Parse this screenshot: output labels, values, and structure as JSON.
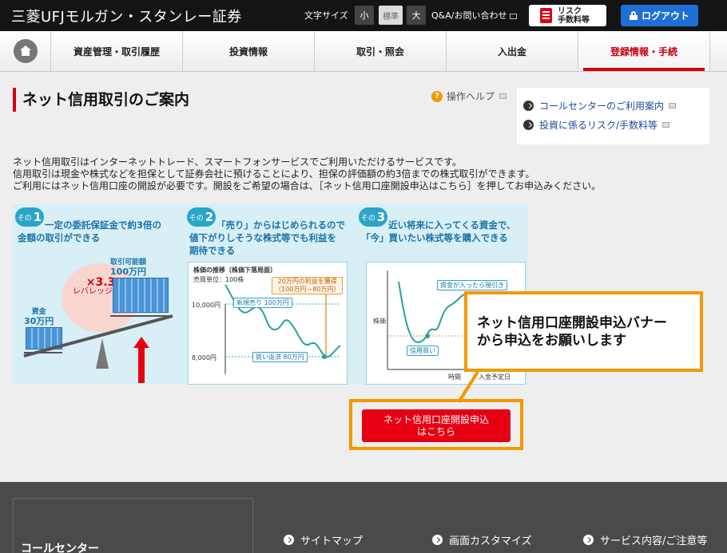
{
  "header": {
    "brand": "三菱UFJモルガン・スタンレー証券",
    "font_size_label": "文字サイズ",
    "font_sizes": [
      "小",
      "標準",
      "大"
    ],
    "qa_link": "Q&A/お問い合わせ",
    "risk_button": [
      "リスク",
      "手数料等"
    ],
    "logout_button": "ログアウト"
  },
  "nav": {
    "items": [
      "資産管理・取引履歴",
      "投資情報",
      "取引・照会",
      "入出金",
      "登録情報・手続"
    ],
    "active_index": 4
  },
  "main": {
    "page_title": "ネット信用取引のご案内",
    "help_link": "操作ヘルプ",
    "side_links": [
      "コールセンターのご利用案内",
      "投資に係るリスク/手数料等"
    ],
    "description": [
      "ネット信用取引はインターネットトレード、スマートフォンサービスでご利用いただけるサービスです。",
      "信用取引は現金や株式などを担保として証券会社に預けることにより、担保の評価額の約3倍までの株式取引ができます。",
      "ご利用にはネット信用口座の開設が必要です。開設をご希望の場合は、［ネット信用口座開設申込はこちら］を押してお申込みください。"
    ]
  },
  "infographic": {
    "steps": [
      {
        "badge_prefix": "その",
        "number": "1",
        "lines": [
          "一定の委託保証金で約3倍の",
          "金額の取引ができる"
        ],
        "leverage_value": "×3.3",
        "leverage_label": "レバレッジ効果",
        "funds_label": "資金",
        "funds_value": "30万円",
        "tradable_label": "取引可能額",
        "tradable_value": "100万円"
      },
      {
        "badge_prefix": "その",
        "number": "2",
        "lines": [
          "「売り」からはじめられるので",
          "値下がりしそうな株式等でも利益を",
          "期待できる"
        ],
        "chart_title": "株価の推移（株価下落局面）",
        "unit": "売買単位：100株",
        "profit_tag": [
          "20万円の利益を獲得",
          "（100万円－80万円）"
        ],
        "y_labels": [
          "10,000円",
          "8,000円"
        ],
        "sell_tag": "新規売り 100万円",
        "buyback_tag": "買い返済 80万円"
      },
      {
        "badge_prefix": "その",
        "number": "3",
        "lines": [
          "近い将来に入ってくる資金で、",
          "「今」買いたい株式等を購入できる"
        ],
        "y_label": "株価",
        "x_label": "時間",
        "buy_tag": "信用買い",
        "cash_tag": "資金が入ったら現引き",
        "deposit_tag": "入金予定日"
      }
    ]
  },
  "overlay": {
    "callout_lines": [
      "ネット信用口座開設申込バナー",
      "から申込をお願いします"
    ],
    "open_button": [
      "ネット信用口座開設申込",
      "はこちら"
    ],
    "accent_color": "#f39800",
    "button_color": "#e60012"
  },
  "footer": {
    "call_center_title": "コールセンター",
    "links": [
      "サイトマップ",
      "画面カスタマイズ",
      "サービス内容/ご注意等"
    ]
  }
}
